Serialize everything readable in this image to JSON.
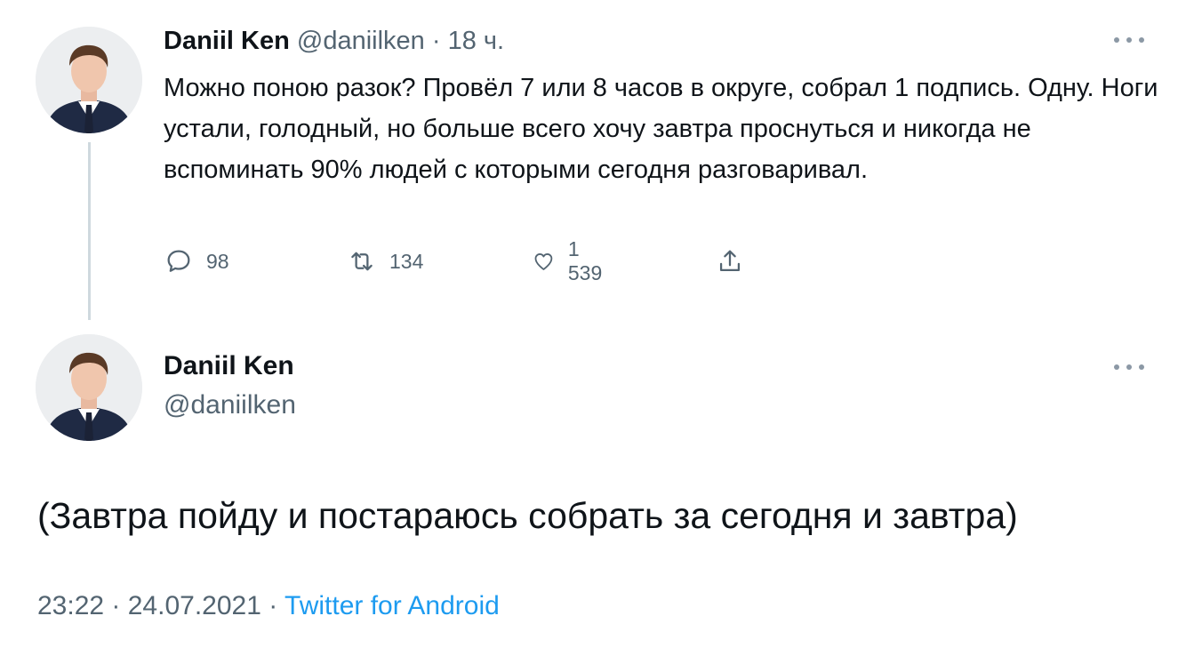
{
  "tweet1": {
    "name": "Daniil Ken",
    "handle": "@daniilken",
    "separator": " · ",
    "time": "18 ч.",
    "text": "Можно поною разок? Провёл 7 или 8 часов в округе, собрал 1 подпись. Одну. Ноги устали, голодный, но больше всего хочу завтра проснуться и никогда не вспоминать 90% людей с которыми сегодня разговаривал.",
    "actions": {
      "reply_count": "98",
      "retweet_count": "134",
      "like_count": "1 539",
      "reply_icon": "reply-icon",
      "retweet_icon": "retweet-icon",
      "like_icon": "heart-icon",
      "share_icon": "share-icon"
    }
  },
  "tweet2": {
    "name": "Daniil Ken",
    "handle": "@daniilken",
    "text": "(Завтра пойду и постараюсь собрать за сегодня и завтра)",
    "time": "23:22",
    "date": "24.07.2021",
    "separator": " · ",
    "source": "Twitter for Android"
  },
  "colors": {
    "text": "#0f1419",
    "muted": "#536471",
    "link": "#1d9bf0",
    "thread_line": "#cfd9de"
  }
}
